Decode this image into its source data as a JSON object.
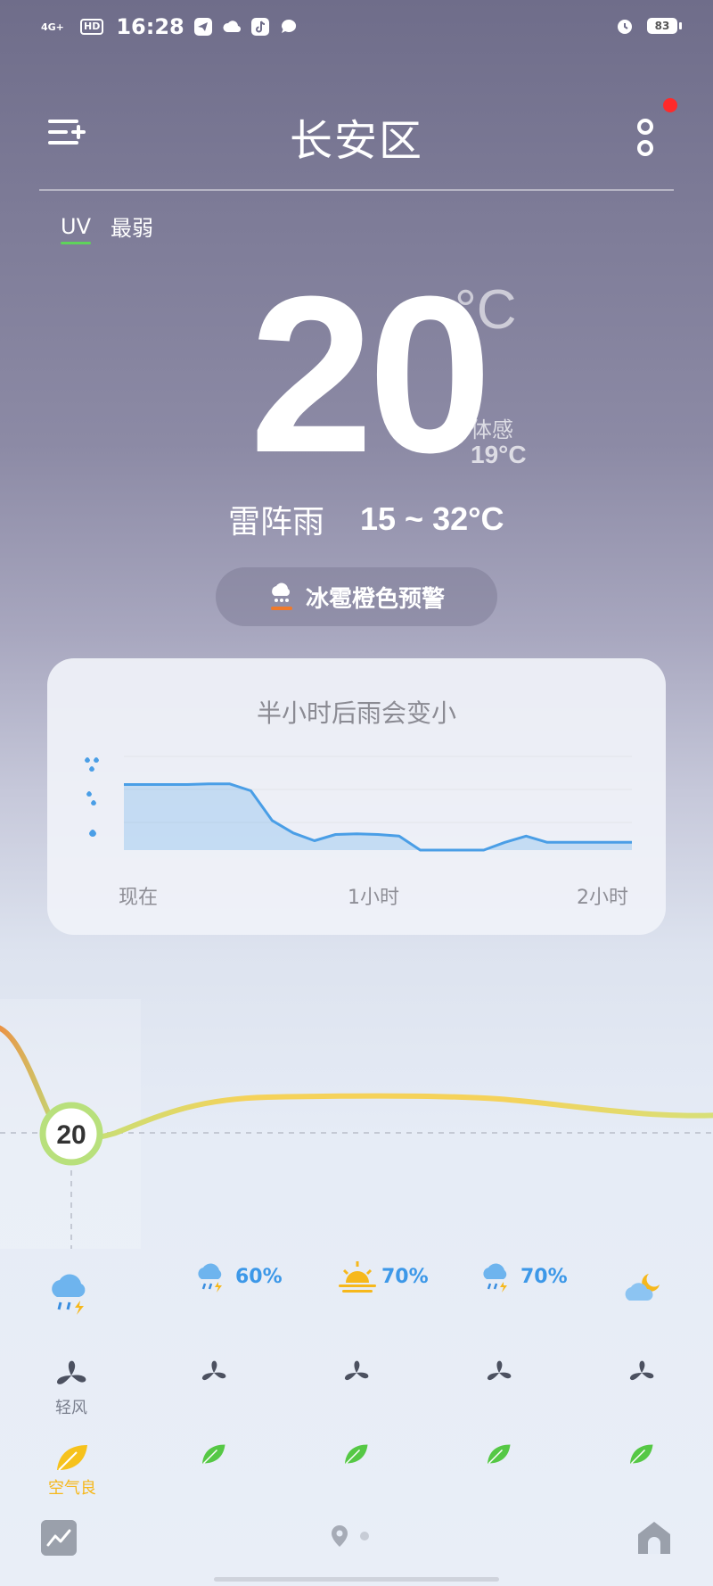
{
  "status_bar": {
    "network": "4G+",
    "hd": "HD",
    "time": "16:28",
    "battery": "83",
    "icons": [
      "telegram-icon",
      "cloud-icon",
      "tiktok-icon",
      "message-icon",
      "alarm-icon"
    ]
  },
  "header": {
    "title": "长安区"
  },
  "uv": {
    "label": "UV",
    "value": "最弱"
  },
  "current": {
    "temperature": "20",
    "unit": "°C",
    "feels_label": "体感",
    "feels_value": "19°C",
    "condition": "雷阵雨",
    "range": "15 ~ 32°C"
  },
  "alert": {
    "text": "冰雹橙色预警",
    "icon": "hail-icon",
    "color": "#f07a2b"
  },
  "rain_card": {
    "title": "半小时后雨会变小",
    "x_labels": [
      "现在",
      "1小时",
      "2小时"
    ]
  },
  "chart_data": {
    "type": "area",
    "x": [
      0,
      5,
      10,
      15,
      20,
      25,
      30,
      35,
      40,
      45,
      50,
      55,
      60,
      65,
      70,
      75,
      80,
      85,
      90,
      95,
      100,
      105,
      110,
      115,
      120
    ],
    "values": [
      2.1,
      2.1,
      2.1,
      2.1,
      2.12,
      2.12,
      1.9,
      0.95,
      0.55,
      0.3,
      0.5,
      0.52,
      0.5,
      0.45,
      0.0,
      0.0,
      0.0,
      0.0,
      0.25,
      0.45,
      0.25,
      0.25,
      0.25,
      0.25,
      0.25
    ],
    "ylim": [
      0,
      3
    ],
    "xlabel": "",
    "ylabel": "",
    "x_tick_labels": [
      "现在",
      "1小时",
      "2小时"
    ],
    "y_levels": [
      "heavy",
      "moderate",
      "light"
    ],
    "color": "#4a9ee6",
    "grid": true
  },
  "hourly_temp": {
    "current_value": "20",
    "colors": [
      "#f0883e",
      "#bfe07a",
      "#f5d25a"
    ]
  },
  "forecast": {
    "columns": [
      {
        "weather_icon": "thunder-rain-icon",
        "pct": "",
        "wind_label": "轻风",
        "aqi_label": "空气良"
      },
      {
        "weather_icon": "thunder-rain-icon",
        "pct": "60%",
        "wind_label": "",
        "aqi_label": ""
      },
      {
        "weather_icon": "sunset-icon",
        "pct": "70%",
        "wind_label": "",
        "aqi_label": ""
      },
      {
        "weather_icon": "thunder-rain-icon",
        "pct": "70%",
        "wind_label": "",
        "aqi_label": ""
      },
      {
        "weather_icon": "cloudy-night-icon",
        "pct": "",
        "wind_label": "",
        "aqi_label": ""
      }
    ]
  }
}
